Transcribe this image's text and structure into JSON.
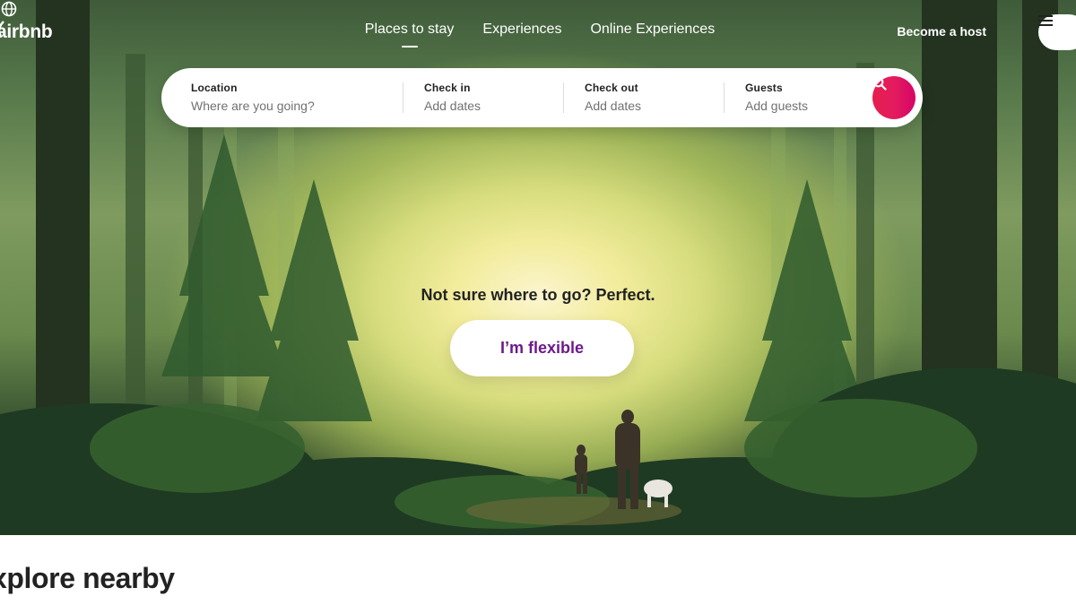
{
  "brand": {
    "name": "airbnb"
  },
  "nav": {
    "tabs": [
      {
        "label": "Places to stay",
        "active": true
      },
      {
        "label": "Experiences",
        "active": false
      },
      {
        "label": "Online Experiences",
        "active": false
      }
    ],
    "host_link": "Become a host",
    "globe_icon": "globe-icon",
    "menu_icon": "hamburger-menu-icon"
  },
  "search": {
    "location": {
      "label": "Location",
      "placeholder": "Where are you going?"
    },
    "check_in": {
      "label": "Check in",
      "placeholder": "Add dates"
    },
    "check_out": {
      "label": "Check out",
      "placeholder": "Add dates"
    },
    "guests": {
      "label": "Guests",
      "placeholder": "Add guests"
    },
    "button_icon": "search-icon"
  },
  "hero": {
    "prompt": "Not sure where to go? Perfect.",
    "cta": "I’m flexible"
  },
  "sections": {
    "explore": "xplore nearby"
  },
  "colors": {
    "accent": "#e31c5f",
    "cta_text": "#6c1a8c",
    "text": "#222222",
    "muted": "#717171"
  }
}
